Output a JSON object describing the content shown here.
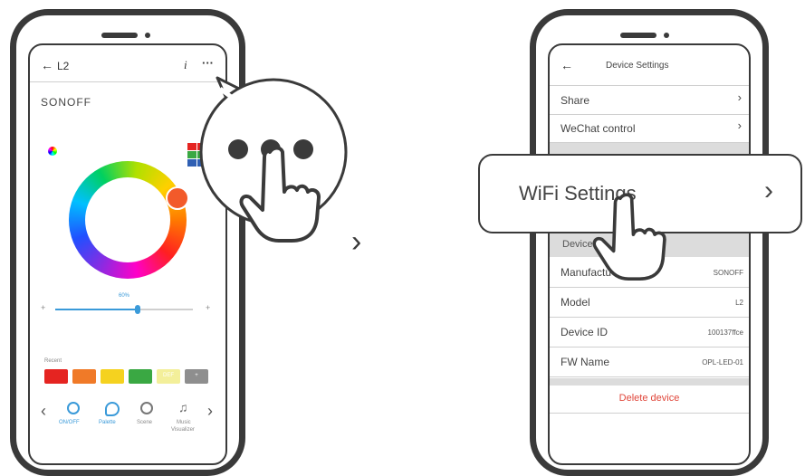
{
  "left_phone": {
    "back_arrow": "←",
    "device_name": "L2",
    "info_icon": "i",
    "more_icon": "···",
    "brand": "SONOFF",
    "brightness": {
      "label": "60%",
      "minus": "+",
      "plus": "+",
      "level": 0.6
    },
    "recent_label": "Recent",
    "recent_swatches": [
      {
        "color": "#e52421",
        "text": ""
      },
      {
        "color": "#f07a28",
        "text": ""
      },
      {
        "color": "#f5d21f",
        "text": ""
      },
      {
        "color": "#3aa843",
        "text": ""
      },
      {
        "color": "#f3ef9a",
        "text": "DEF"
      },
      {
        "color": "#8e8e8e",
        "text": "+"
      }
    ],
    "nav": {
      "prev": "‹",
      "next": "›",
      "items": [
        {
          "label": "ON/OFF",
          "icon": "power-icon"
        },
        {
          "label": "Palette",
          "icon": "palette-icon"
        },
        {
          "label": "Scene",
          "icon": "scene-icon"
        },
        {
          "label": "Music",
          "label2": "Visualizer",
          "icon": "music-icon"
        }
      ]
    }
  },
  "arrow_between": "›",
  "right_phone": {
    "back_arrow": "←",
    "title": "Device Settings",
    "rows": [
      {
        "label": "Share",
        "chevron": "›"
      },
      {
        "label": "WeChat control",
        "chevron": "›"
      }
    ],
    "section_device": "Device",
    "info_rows": [
      {
        "label": "Manufactu",
        "value": "SONOFF"
      },
      {
        "label": "Model",
        "value": "L2"
      },
      {
        "label": "Device ID",
        "value": "100137ffce"
      },
      {
        "label": "FW Name",
        "value": "OPL-LED-01"
      }
    ],
    "delete_label": "Delete device"
  },
  "callout": {
    "wifi_label": "WiFi Settings",
    "wifi_chevron": "›"
  },
  "colors": {
    "accent_blue": "#3a9ad9",
    "delete_red": "#e0463a",
    "frame": "#3a3a3a"
  }
}
